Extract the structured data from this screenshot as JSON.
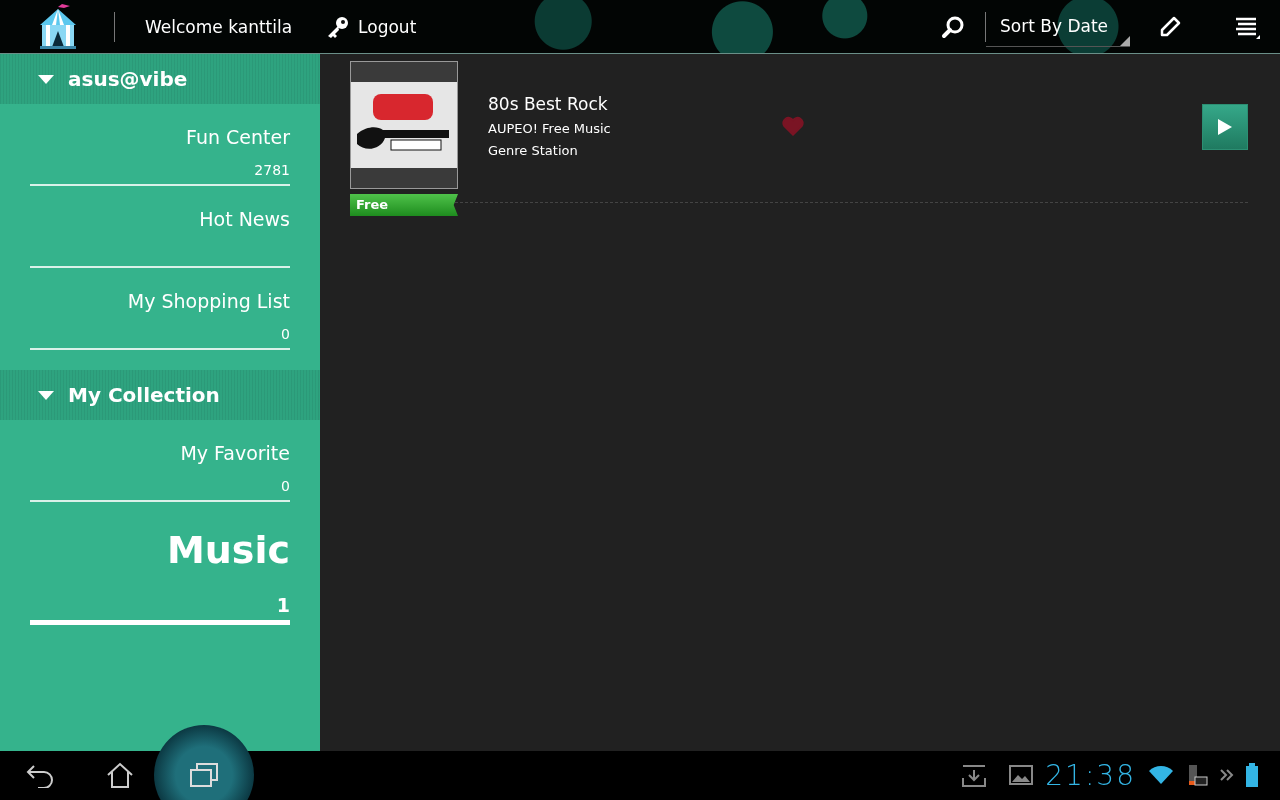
{
  "top_bar": {
    "welcome": "Welcome kanttila",
    "logout": "Logout",
    "sort": "Sort By Date"
  },
  "sidebar": {
    "sections": [
      {
        "title": "asus@vibe",
        "expanded": true,
        "items": [
          {
            "label": "Fun Center",
            "count": "2781",
            "selected": false
          },
          {
            "label": "Hot News",
            "selected": false
          },
          {
            "label": "My Shopping List",
            "count": "0",
            "selected": false
          }
        ]
      },
      {
        "title": "My Collection",
        "expanded": true,
        "items": [
          {
            "label": "My Favorite",
            "count": "0",
            "selected": false
          },
          {
            "label": "Music",
            "count": "1",
            "selected": true
          }
        ]
      }
    ]
  },
  "list": [
    {
      "title": "80s Best Rock",
      "subtitle": "AUPEO! Free Music",
      "category": "Genre Station",
      "badge": "Free",
      "favorite": true
    }
  ],
  "status_bar": {
    "time": "21:38"
  }
}
